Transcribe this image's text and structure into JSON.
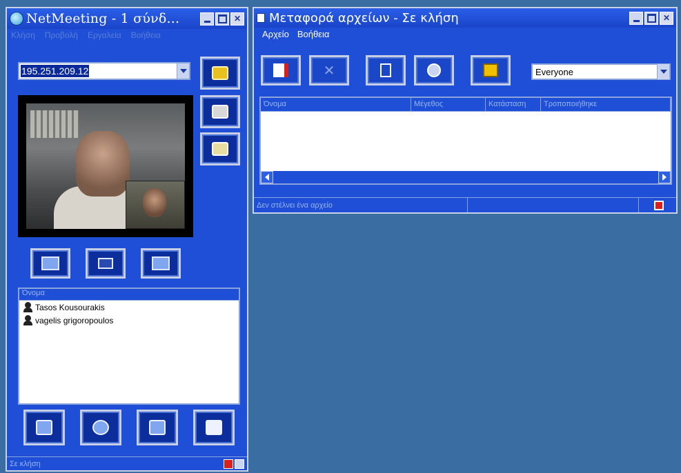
{
  "left_window": {
    "title": "NetMeeting - 1 σύνδ...",
    "menu": [
      "Κλήση",
      "Προβολή",
      "Εργαλεία",
      "Βοήθεια"
    ],
    "address_value": "195.251.209.12",
    "participants_header": "Όνομα",
    "participants": [
      "Tasos Kousourakis",
      "vagelis grigoropoulos"
    ],
    "status": "Σε κλήση"
  },
  "right_window": {
    "title": "Μεταφορά αρχείων - Σε κλήση",
    "menu": [
      "Αρχείο",
      "Βοήθεια"
    ],
    "recipient": "Everyone",
    "columns": [
      "Όνομα",
      "Μέγεθος",
      "Κατάσταση",
      "Τροποποιήθηκε"
    ],
    "status": "Δεν στέλνει ένα αρχείο"
  },
  "colors": {
    "window_blue": "#1e4fd6",
    "desktop": "#3a6da1"
  }
}
